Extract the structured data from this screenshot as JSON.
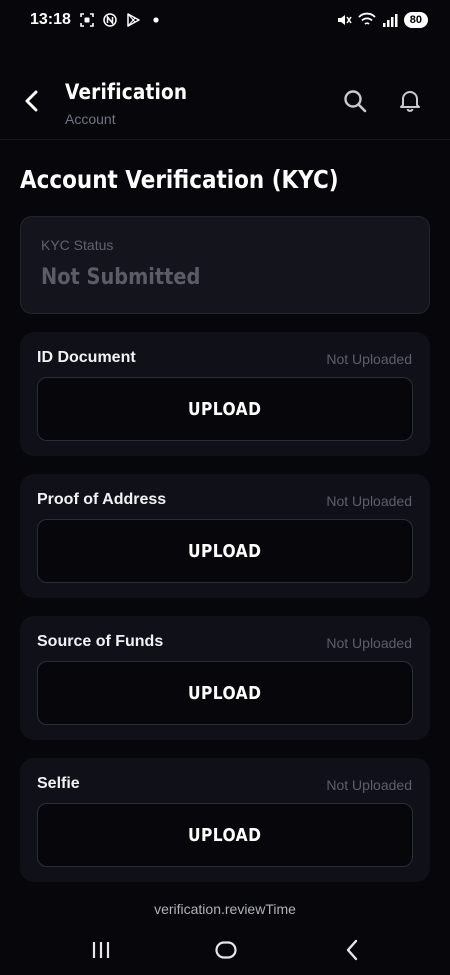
{
  "status_bar": {
    "time": "13:18",
    "battery": "80",
    "icons": [
      "screenshot-icon",
      "n-app-icon",
      "play-store-icon",
      "dot-icon",
      "mute-icon",
      "wifi-icon",
      "signal-icon"
    ]
  },
  "header": {
    "title": "Verification",
    "subtitle": "Account",
    "icons": [
      "back-arrow-icon",
      "search-icon",
      "bell-icon"
    ]
  },
  "page": {
    "title": "Account Verification (KYC)"
  },
  "kyc_status": {
    "label": "KYC Status",
    "value": "Not Submitted"
  },
  "documents": [
    {
      "title": "ID Document",
      "status": "Not Uploaded",
      "button": "UPLOAD"
    },
    {
      "title": "Proof of Address",
      "status": "Not Uploaded",
      "button": "UPLOAD"
    },
    {
      "title": "Source of Funds",
      "status": "Not Uploaded",
      "button": "UPLOAD"
    },
    {
      "title": "Selfie",
      "status": "Not Uploaded",
      "button": "UPLOAD"
    }
  ],
  "footer": {
    "note": "verification.reviewTime"
  },
  "nav": {
    "icons": [
      "recent-apps-icon",
      "home-icon",
      "back-icon"
    ]
  },
  "colors": {
    "background": "#07070b",
    "card": "#101118",
    "muted_text": "#5c5f6a"
  }
}
